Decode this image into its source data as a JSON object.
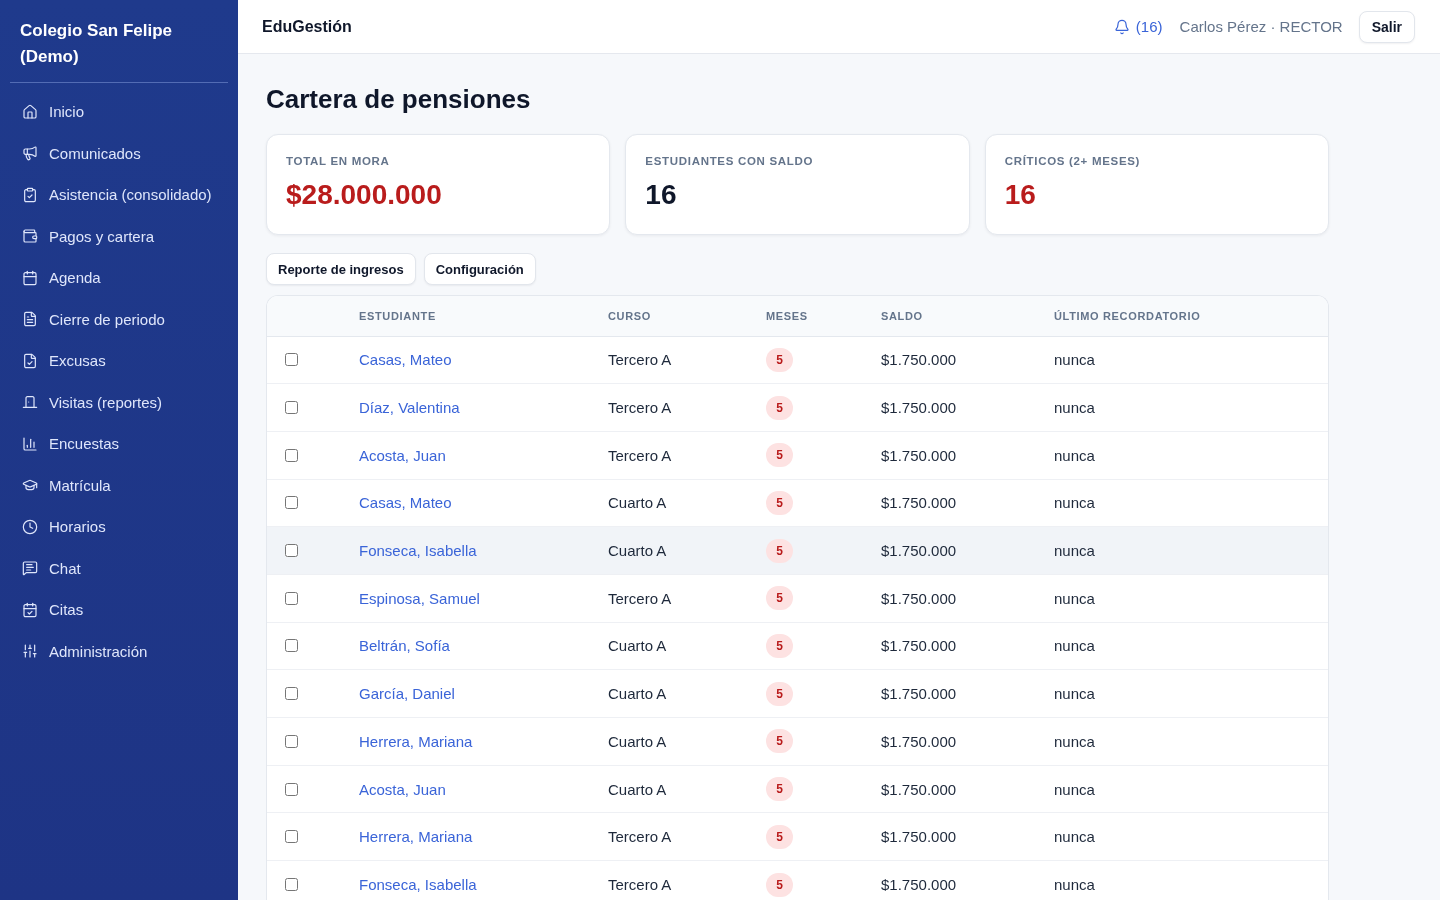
{
  "sidebar": {
    "title": "Colegio San Felipe (Demo)",
    "items": [
      {
        "label": "Inicio"
      },
      {
        "label": "Comunicados"
      },
      {
        "label": "Asistencia (consolidado)"
      },
      {
        "label": "Pagos y cartera"
      },
      {
        "label": "Agenda"
      },
      {
        "label": "Cierre de periodo"
      },
      {
        "label": "Excusas"
      },
      {
        "label": "Visitas (reportes)"
      },
      {
        "label": "Encuestas"
      },
      {
        "label": "Matrícula"
      },
      {
        "label": "Horarios"
      },
      {
        "label": "Chat"
      },
      {
        "label": "Citas"
      },
      {
        "label": "Administración"
      }
    ]
  },
  "topbar": {
    "app_name": "EduGestión",
    "notifications": "(16)",
    "user": "Carlos Pérez · RECTOR",
    "logout": "Salir"
  },
  "page": {
    "title": "Cartera de pensiones",
    "stats": [
      {
        "label": "TOTAL EN MORA",
        "value": "$28.000.000",
        "kind": "danger"
      },
      {
        "label": "ESTUDIANTES CON SALDO",
        "value": "16",
        "kind": "plain"
      },
      {
        "label": "CRÍTICOS (2+ MESES)",
        "value": "16",
        "kind": "danger"
      }
    ],
    "actions": [
      "Reporte de ingresos",
      "Configuración"
    ]
  },
  "table": {
    "columns": [
      "ESTUDIANTE",
      "CURSO",
      "MESES",
      "SALDO",
      "ÚLTIMO RECORDATORIO"
    ],
    "rows": [
      {
        "checked": false,
        "highlighted": false,
        "student": "Casas, Mateo",
        "course": "Tercero A",
        "months": "5",
        "balance": "$1.750.000",
        "last_reminder": "nunca"
      },
      {
        "checked": false,
        "highlighted": false,
        "student": "Díaz, Valentina",
        "course": "Tercero A",
        "months": "5",
        "balance": "$1.750.000",
        "last_reminder": "nunca"
      },
      {
        "checked": false,
        "highlighted": false,
        "student": "Acosta, Juan",
        "course": "Tercero A",
        "months": "5",
        "balance": "$1.750.000",
        "last_reminder": "nunca"
      },
      {
        "checked": false,
        "highlighted": false,
        "student": "Casas, Mateo",
        "course": "Cuarto A",
        "months": "5",
        "balance": "$1.750.000",
        "last_reminder": "nunca"
      },
      {
        "checked": false,
        "highlighted": true,
        "student": "Fonseca, Isabella",
        "course": "Cuarto A",
        "months": "5",
        "balance": "$1.750.000",
        "last_reminder": "nunca"
      },
      {
        "checked": false,
        "highlighted": false,
        "student": "Espinosa, Samuel",
        "course": "Tercero A",
        "months": "5",
        "balance": "$1.750.000",
        "last_reminder": "nunca"
      },
      {
        "checked": false,
        "highlighted": false,
        "student": "Beltrán, Sofía",
        "course": "Cuarto A",
        "months": "5",
        "balance": "$1.750.000",
        "last_reminder": "nunca"
      },
      {
        "checked": false,
        "highlighted": false,
        "student": "García, Daniel",
        "course": "Cuarto A",
        "months": "5",
        "balance": "$1.750.000",
        "last_reminder": "nunca"
      },
      {
        "checked": false,
        "highlighted": false,
        "student": "Herrera, Mariana",
        "course": "Cuarto A",
        "months": "5",
        "balance": "$1.750.000",
        "last_reminder": "nunca"
      },
      {
        "checked": false,
        "highlighted": false,
        "student": "Acosta, Juan",
        "course": "Cuarto A",
        "months": "5",
        "balance": "$1.750.000",
        "last_reminder": "nunca"
      },
      {
        "checked": false,
        "highlighted": false,
        "student": "Herrera, Mariana",
        "course": "Tercero A",
        "months": "5",
        "balance": "$1.750.000",
        "last_reminder": "nunca"
      },
      {
        "checked": false,
        "highlighted": false,
        "student": "Fonseca, Isabella",
        "course": "Tercero A",
        "months": "5",
        "balance": "$1.750.000",
        "last_reminder": "nunca"
      }
    ]
  }
}
